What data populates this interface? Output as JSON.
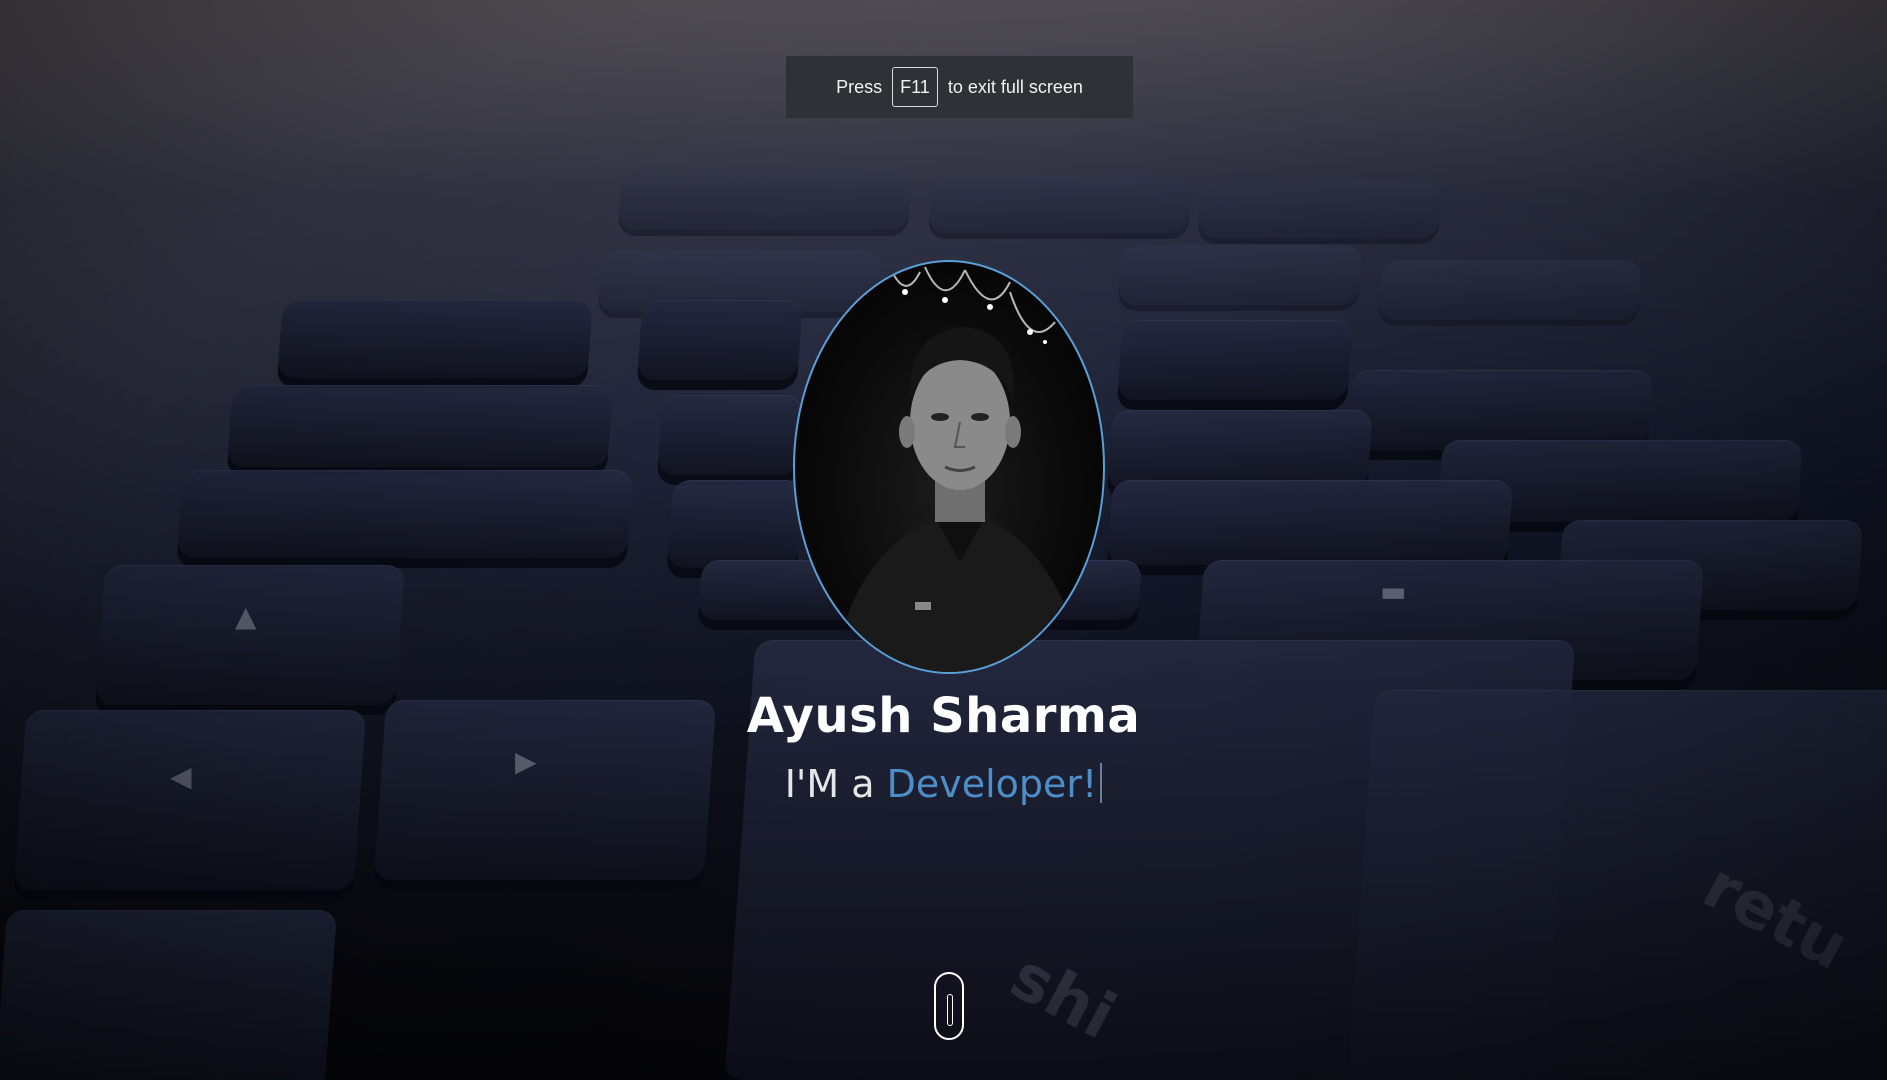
{
  "fullscreen_notice": {
    "before": "Press",
    "key": "F11",
    "after": "to exit full screen"
  },
  "hero": {
    "name": "Ayush Sharma",
    "tagline_prefix": "I'M a",
    "tagline_role": "Developer!"
  },
  "background": {
    "key_labels": [
      "shi",
      "retu"
    ]
  },
  "colors": {
    "accent": "#4d8ec9",
    "avatar_border": "#5b9fd6",
    "notice_bg": "#2f3136",
    "text": "#ffffff"
  },
  "icons": {
    "scroll": "mouse-scroll-icon"
  }
}
